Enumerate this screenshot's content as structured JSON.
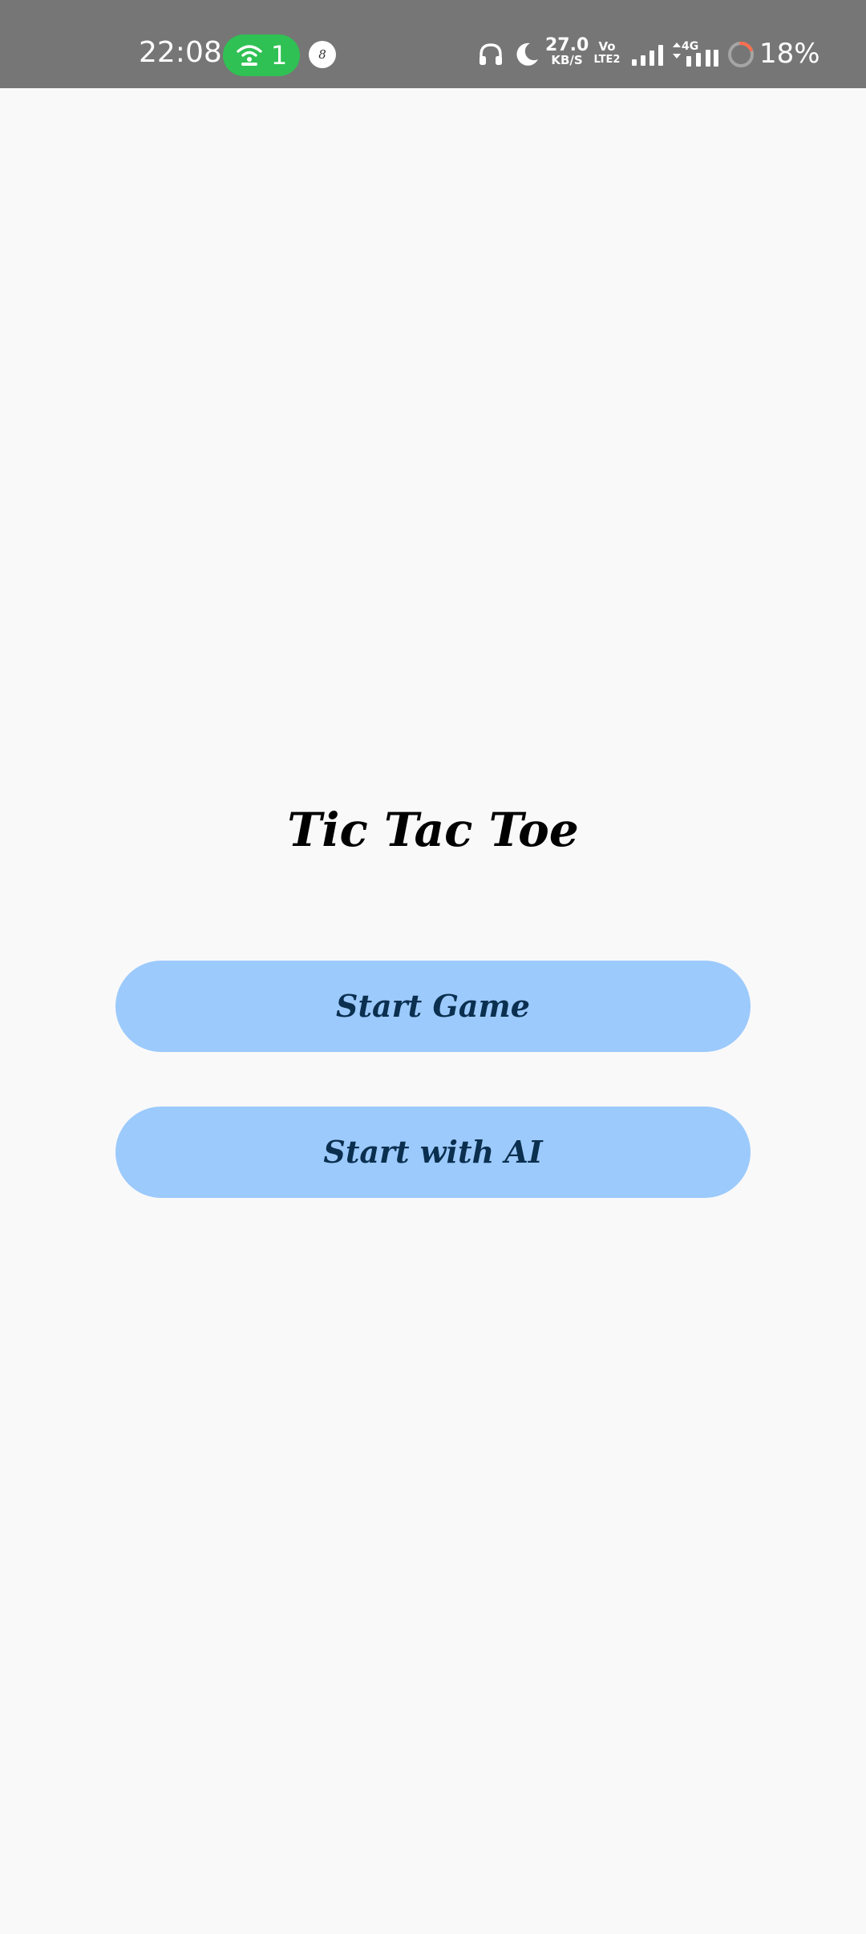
{
  "status_bar": {
    "time": "22:08",
    "hotspot_count": "1",
    "notification_badge": "8",
    "net_speed_value": "27.0",
    "net_speed_unit": "KB/S",
    "volte_top": "Vo",
    "volte_bottom": "LTE2",
    "network_type": "4G",
    "battery_percent": "18%",
    "icons": [
      "hotspot-icon",
      "headphones-icon",
      "do-not-disturb-moon-icon",
      "signal-bars-icon",
      "data-arrows-icon",
      "battery-ring-icon"
    ],
    "colors": {
      "bar_background": "#767676",
      "hotspot_pill": "#2fc153",
      "battery_low": "#ff6f4f"
    },
    "battery_level": 0.18
  },
  "main": {
    "title": "Tic Tac Toe",
    "buttons": {
      "start_game": "Start Game",
      "start_ai": "Start with AI"
    },
    "colors": {
      "background": "#f9f9fa",
      "button_fill": "#9ccafc",
      "button_text": "#0b2f4f",
      "title_text": "#000000"
    }
  }
}
